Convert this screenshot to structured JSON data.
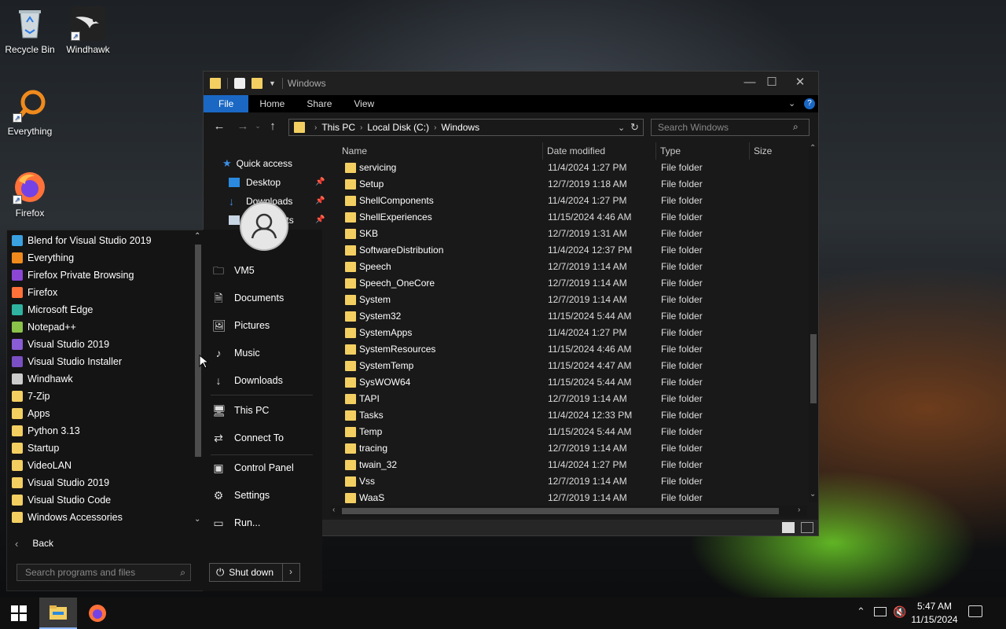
{
  "desktop": {
    "icons": [
      {
        "label": "Recycle Bin"
      },
      {
        "label": "Windhawk"
      },
      {
        "label": "Everything"
      },
      {
        "label": "Firefox"
      }
    ]
  },
  "explorer": {
    "title": "Windows",
    "ribbon_tabs": [
      "File",
      "Home",
      "Share",
      "View"
    ],
    "breadcrumb": [
      "This PC",
      "Local Disk (C:)",
      "Windows"
    ],
    "search_placeholder": "Search Windows",
    "nav": {
      "quick_access": "Quick access",
      "items": [
        "Desktop",
        "Downloads",
        "Documents"
      ]
    },
    "columns": [
      "Name",
      "Date modified",
      "Type",
      "Size"
    ],
    "files": [
      {
        "name": "servicing",
        "date": "11/4/2024 1:27 PM",
        "type": "File folder"
      },
      {
        "name": "Setup",
        "date": "12/7/2019 1:18 AM",
        "type": "File folder"
      },
      {
        "name": "ShellComponents",
        "date": "11/4/2024 1:27 PM",
        "type": "File folder"
      },
      {
        "name": "ShellExperiences",
        "date": "11/15/2024 4:46 AM",
        "type": "File folder"
      },
      {
        "name": "SKB",
        "date": "12/7/2019 1:31 AM",
        "type": "File folder"
      },
      {
        "name": "SoftwareDistribution",
        "date": "11/4/2024 12:37 PM",
        "type": "File folder"
      },
      {
        "name": "Speech",
        "date": "12/7/2019 1:14 AM",
        "type": "File folder"
      },
      {
        "name": "Speech_OneCore",
        "date": "12/7/2019 1:14 AM",
        "type": "File folder"
      },
      {
        "name": "System",
        "date": "12/7/2019 1:14 AM",
        "type": "File folder"
      },
      {
        "name": "System32",
        "date": "11/15/2024 5:44 AM",
        "type": "File folder"
      },
      {
        "name": "SystemApps",
        "date": "11/4/2024 1:27 PM",
        "type": "File folder"
      },
      {
        "name": "SystemResources",
        "date": "11/15/2024 4:46 AM",
        "type": "File folder"
      },
      {
        "name": "SystemTemp",
        "date": "11/15/2024 4:47 AM",
        "type": "File folder"
      },
      {
        "name": "SysWOW64",
        "date": "11/15/2024 5:44 AM",
        "type": "File folder"
      },
      {
        "name": "TAPI",
        "date": "12/7/2019 1:14 AM",
        "type": "File folder"
      },
      {
        "name": "Tasks",
        "date": "11/4/2024 12:33 PM",
        "type": "File folder"
      },
      {
        "name": "Temp",
        "date": "11/15/2024 5:44 AM",
        "type": "File folder"
      },
      {
        "name": "tracing",
        "date": "12/7/2019 1:14 AM",
        "type": "File folder"
      },
      {
        "name": "twain_32",
        "date": "11/4/2024 1:27 PM",
        "type": "File folder"
      },
      {
        "name": "Vss",
        "date": "12/7/2019 1:14 AM",
        "type": "File folder"
      },
      {
        "name": "WaaS",
        "date": "12/7/2019 1:14 AM",
        "type": "File folder"
      }
    ]
  },
  "start_menu": {
    "programs": [
      {
        "label": "Blend for Visual Studio 2019",
        "icon": "blend-icon",
        "color": "#3aa0e0"
      },
      {
        "label": "Everything",
        "icon": "everything-icon",
        "color": "#f08a1c"
      },
      {
        "label": "Firefox Private Browsing",
        "icon": "firefox-private-icon",
        "color": "#8b46d6"
      },
      {
        "label": "Firefox",
        "icon": "firefox-icon",
        "color": "#ff7139"
      },
      {
        "label": "Microsoft Edge",
        "icon": "edge-icon",
        "color": "#2fb3a0"
      },
      {
        "label": "Notepad++",
        "icon": "notepadpp-icon",
        "color": "#8bc34a"
      },
      {
        "label": "Visual Studio 2019",
        "icon": "visual-studio-icon",
        "color": "#8a5cd6"
      },
      {
        "label": "Visual Studio Installer",
        "icon": "vs-installer-icon",
        "color": "#7a4fc4"
      },
      {
        "label": "Windhawk",
        "icon": "windhawk-icon",
        "color": "#cccccc"
      },
      {
        "label": "7-Zip",
        "icon": "folder-icon",
        "color": "#f3cf62"
      },
      {
        "label": "Apps",
        "icon": "folder-icon",
        "color": "#f3cf62"
      },
      {
        "label": "Python 3.13",
        "icon": "folder-icon",
        "color": "#f3cf62"
      },
      {
        "label": "Startup",
        "icon": "folder-icon",
        "color": "#f3cf62"
      },
      {
        "label": "VideoLAN",
        "icon": "folder-icon",
        "color": "#f3cf62"
      },
      {
        "label": "Visual Studio 2019",
        "icon": "folder-icon",
        "color": "#f3cf62"
      },
      {
        "label": "Visual Studio Code",
        "icon": "folder-icon",
        "color": "#f3cf62"
      },
      {
        "label": "Windows Accessories",
        "icon": "folder-icon",
        "color": "#f3cf62"
      }
    ],
    "back_label": "Back",
    "search_placeholder": "Search programs and files",
    "right_links": [
      {
        "label": "VM5",
        "icon": "user-folder-icon"
      },
      {
        "label": "Documents",
        "icon": "documents-icon"
      },
      {
        "label": "Pictures",
        "icon": "pictures-icon"
      },
      {
        "label": "Music",
        "icon": "music-icon"
      },
      {
        "label": "Downloads",
        "icon": "downloads-icon"
      },
      {
        "label": "This PC",
        "icon": "this-pc-icon"
      },
      {
        "label": "Connect To",
        "icon": "connect-icon"
      },
      {
        "label": "Control Panel",
        "icon": "control-panel-icon"
      },
      {
        "label": "Settings",
        "icon": "gear-icon"
      },
      {
        "label": "Run...",
        "icon": "run-icon"
      }
    ],
    "shutdown_label": "Shut down"
  },
  "taskbar": {
    "time": "5:47 AM",
    "date": "11/15/2024"
  }
}
